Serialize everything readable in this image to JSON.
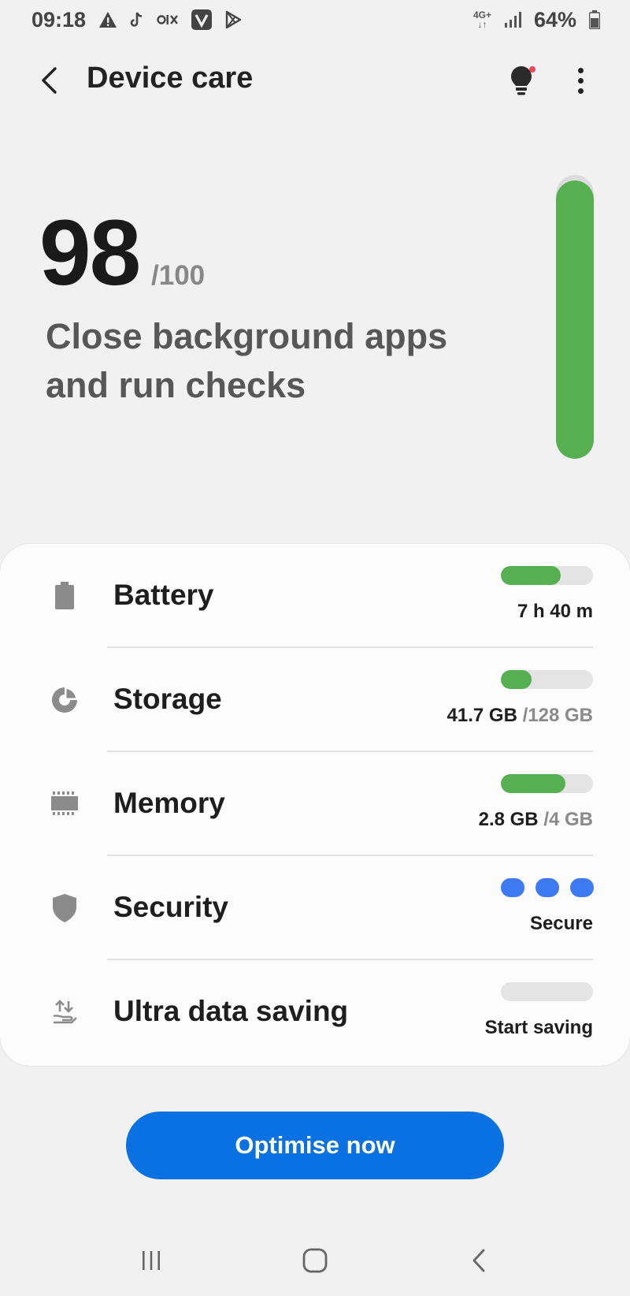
{
  "status_bar": {
    "time": "09:18",
    "notification_icons": [
      "warning-icon",
      "tiktok-icon",
      "olx-icon",
      "v-app-icon",
      "play-store-icon"
    ],
    "network": "4G+",
    "battery_percent": "64%"
  },
  "header": {
    "title": "Device care",
    "tips_has_badge": true
  },
  "score": {
    "value": "98",
    "max": "/100",
    "description": "Close background apps and run checks",
    "gauge_fraction": 0.98,
    "gauge_color": "#56b052"
  },
  "items": [
    {
      "label": "Battery",
      "value": "7 h 40 m",
      "bar_fraction": 0.65,
      "icon": "battery-icon"
    },
    {
      "label": "Storage",
      "value": "41.7 GB",
      "value_total": "/128 GB",
      "bar_fraction": 0.33,
      "icon": "storage-icon"
    },
    {
      "label": "Memory",
      "value": "2.8 GB",
      "value_total": "/4 GB",
      "bar_fraction": 0.7,
      "icon": "memory-icon"
    },
    {
      "label": "Security",
      "value": "Secure",
      "security_level": 3,
      "security_levels": 3,
      "icon": "shield-icon"
    },
    {
      "label": "Ultra data saving",
      "value": "Start saving",
      "bar_fraction": 0,
      "icon": "data-saving-icon"
    }
  ],
  "actions": {
    "optimise_label": "Optimise now"
  },
  "colors": {
    "accent": "#0971e1",
    "good": "#56b052",
    "security_active": "#3e7af1"
  }
}
